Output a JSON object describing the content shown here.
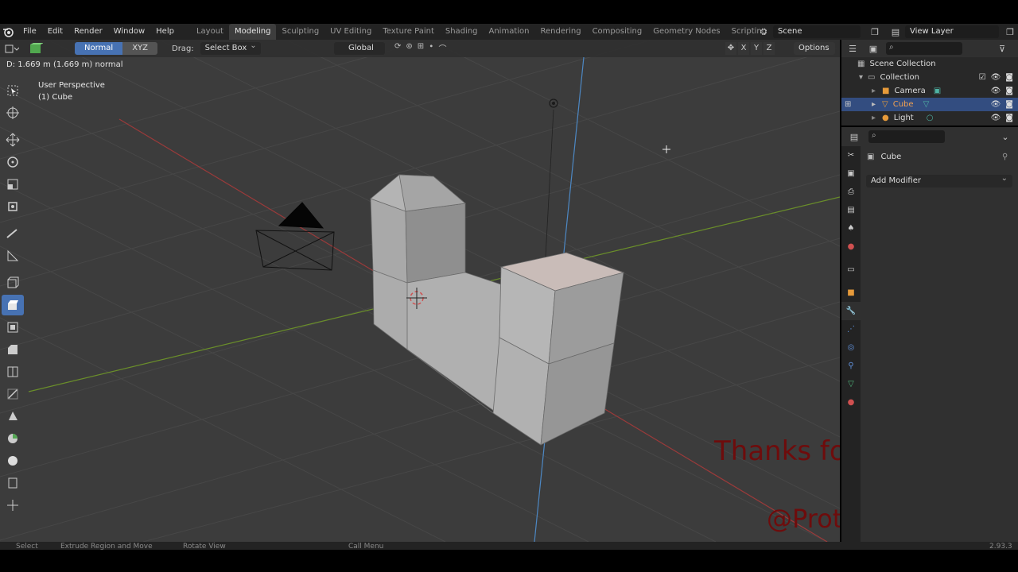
{
  "menu": {
    "items": [
      "File",
      "Edit",
      "Render",
      "Window",
      "Help"
    ]
  },
  "workspaces": {
    "tabs": [
      "Layout",
      "Modeling",
      "Sculpting",
      "UV Editing",
      "Texture Paint",
      "Shading",
      "Animation",
      "Rendering",
      "Compositing",
      "Geometry Nodes",
      "Scripting"
    ],
    "active": "Modeling"
  },
  "scene": {
    "name": "Scene"
  },
  "view_layer": {
    "name": "View Layer"
  },
  "viewport_header": {
    "normal_label": "Normal",
    "xyz_label": "XYZ",
    "drag_label": "Drag:",
    "drag_value": "Select Box",
    "orientation": "Global",
    "axes": [
      "X",
      "Y",
      "Z"
    ],
    "options_label": "Options"
  },
  "viewport": {
    "status_text": "D: 1.669 m (1.669 m) normal",
    "perspective": "User Perspective",
    "active_object": "(1) Cube"
  },
  "overlay": {
    "thanks_text": "Thanks for watching!",
    "handle_text": "@Protus Odie"
  },
  "outliner": {
    "root": "Scene Collection",
    "collection": "Collection",
    "items": [
      {
        "label": "Camera",
        "selected": false
      },
      {
        "label": "Cube",
        "selected": true
      },
      {
        "label": "Light",
        "selected": false
      }
    ]
  },
  "properties": {
    "object_name": "Cube",
    "add_modifier_label": "Add Modifier"
  },
  "statusbar": {
    "select": "Select",
    "extrude": "Extrude Region and Move",
    "rotate": "Rotate View",
    "call_menu": "Call Menu",
    "version": "2.93.3"
  },
  "colors": {
    "accent": "#4772b3",
    "overlay_text": "#6e0c0c",
    "x_axis": "#9b3a3a",
    "y_axis": "#6a8e2a",
    "z_axis": "#4d88c4"
  }
}
